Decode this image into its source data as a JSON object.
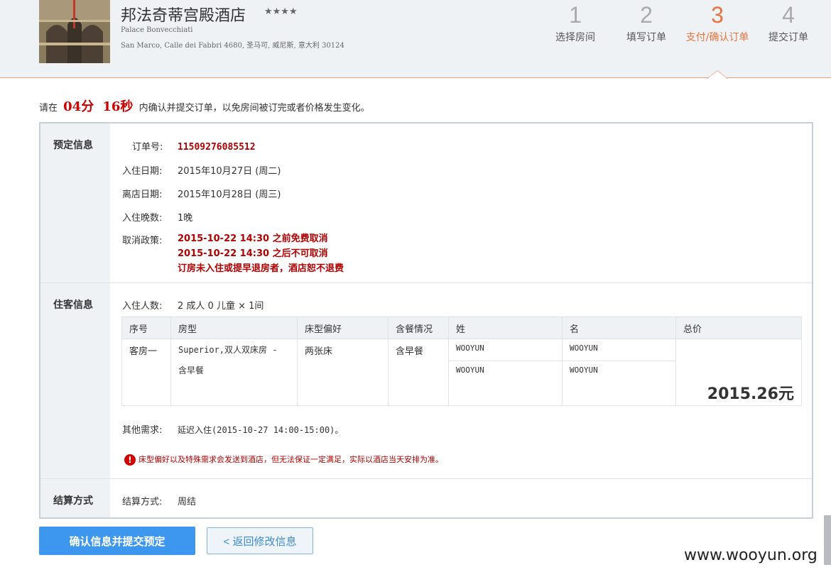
{
  "hotel": {
    "name": "邦法奇蒂宫殿酒店",
    "stars": "★★★★",
    "name_en": "Palace Bonvecchiati",
    "address": "San Marco, Calle dei Fabbri 4680, 圣马可, 威尼斯, 意大利 30124"
  },
  "steps": [
    {
      "num": "1",
      "label": "选择房间"
    },
    {
      "num": "2",
      "label": "填写订单"
    },
    {
      "num": "3",
      "label": "支付/确认订单"
    },
    {
      "num": "4",
      "label": "提交订单"
    }
  ],
  "countdown": {
    "prefix": "请在",
    "minutes": "04分",
    "seconds": "16秒",
    "suffix": "内确认并提交订单，以免房间被订完或者价格发生变化。"
  },
  "booking": {
    "section_title": "预定信息",
    "order_no_label": "订单号:",
    "order_no": "11509276085512",
    "checkin_label": "入住日期:",
    "checkin": "2015年10月27日 (周二)",
    "checkout_label": "离店日期:",
    "checkout": "2015年10月28日 (周三)",
    "nights_label": "入住晚数:",
    "nights": "1晚",
    "policy_label": "取消政策:",
    "policy_lines": [
      "2015-10-22 14:30 之前免费取消",
      "2015-10-22 14:30 之后不可取消",
      "订房未入住或提早退房者，酒店恕不退费"
    ]
  },
  "guests": {
    "section_title": "住客信息",
    "count_label": "入住人数:",
    "count": "2 成人 0 儿童 × 1间",
    "columns": [
      "序号",
      "房型",
      "床型偏好",
      "含餐情况",
      "姓",
      "名",
      "总价"
    ],
    "room": {
      "index": "客房一",
      "room_type": "Superior,双人双床房 - 含早餐",
      "bed": "两张床",
      "meal": "含早餐",
      "guests": [
        {
          "last": "WOOYUN",
          "first": "WOOYUN"
        },
        {
          "last": "WOOYUN",
          "first": "WOOYUN"
        }
      ],
      "total": "2015.26元"
    },
    "other_label": "其他需求:",
    "other": "延迟入住(2015-10-27 14:00-15:00)。",
    "warning": "床型偏好以及特殊需求会发送到酒店，但无法保证一定满足，实际以酒店当天安排为准。"
  },
  "settlement": {
    "section_title": "结算方式",
    "label": "结算方式:",
    "value": "周结"
  },
  "actions": {
    "confirm": "确认信息并提交预定",
    "back": "< 返回修改信息"
  },
  "watermark": "www.wooyun.org",
  "colors": {
    "accent": "#e5743f",
    "price": "#cc0000",
    "button": "#3d97ef"
  }
}
